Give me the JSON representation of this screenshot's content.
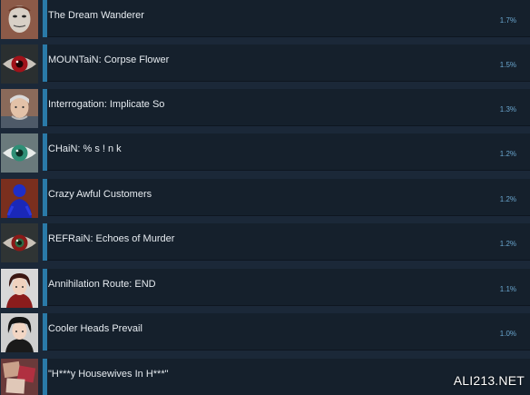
{
  "achievements": [
    {
      "name": "The Dream Wanderer",
      "percent": "1.7%",
      "icon": "face-portrait-icon"
    },
    {
      "name": "MOUNTaiN: Corpse Flower",
      "percent": "1.5%",
      "icon": "red-eye-icon"
    },
    {
      "name": "Interrogation: Implicate So",
      "percent": "1.3%",
      "icon": "old-man-portrait-icon"
    },
    {
      "name": "CHaiN: % s ! n k",
      "percent": "1.2%",
      "icon": "green-eye-icon"
    },
    {
      "name": "Crazy Awful Customers",
      "percent": "1.2%",
      "icon": "blue-figure-icon"
    },
    {
      "name": "REFRaiN: Echoes of Murder",
      "percent": "1.2%",
      "icon": "green-eye-icon"
    },
    {
      "name": "Annihilation Route: END",
      "percent": "1.1%",
      "icon": "red-hair-portrait-icon"
    },
    {
      "name": "Cooler Heads Prevail",
      "percent": "1.0%",
      "icon": "dark-hair-portrait-icon"
    },
    {
      "name": "\"H***y Housewives In H***\"",
      "percent": "",
      "icon": "collage-icon"
    }
  ],
  "watermark": "ALI213.NET",
  "colors": {
    "background": "#1b2838",
    "panel": "#15202c",
    "accent": "#2a7aa8",
    "title": "#e6ebf0",
    "percent": "#6aa6cf"
  }
}
